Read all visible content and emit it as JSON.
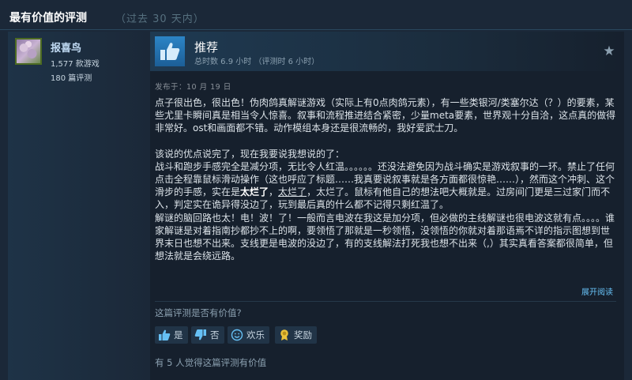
{
  "header": {
    "title": "最有价值的评测",
    "subtitle": "（过去 30 天内）"
  },
  "author": {
    "name": "报喜鸟",
    "games": "1,577 款游戏",
    "reviews": "180 篇评测"
  },
  "review": {
    "recommendation": "推荐",
    "hours": "总时数 6.9 小时 （评测时 6 小时）",
    "posted": "发布于：10 月 19 日",
    "paragraphs": [
      "点子很出色，很出色！伪肉鸽真解谜游戏（实际上有0点肉鸽元素），有一些类银河/类塞尔达（？）的要素，某些尤里卡瞬间真是相当令人惊喜。叙事和流程推进结合紧密，少量meta要素，世界观十分自洽，这点真的做得非常好。ost和画面都不错。动作模组本身还是很流畅的，我好爱武士刀。",
      "该说的优点说完了，现在我要说我想说的了："
    ],
    "para3_a": "战斗和跑步手感完全是减分项，无比令人红温。。。。。。还没法避免因为战斗确实是游戏叙事的一环。禁止了任何点击全程靠鼠标滑动操作（这也呼应了标题……我真要说叙事就是各方面都很惊艳……），然而这个冲刺、这个滑步的手感，实在是",
    "para3_bold": "太烂了",
    "para3_sep": "，",
    "para3_underline": "太烂了",
    "para3_b": "，太烂了。鼠标有他自己的想法吧大概就是。过房间门更是三过家门而不入，判定实在诡异得没边了，玩到最后真的什么都不记得只剩红温了。",
    "para4": "解谜的脑回路也太！电！波！了！一般而言电波在我这是加分项，但必做的主线解谜也很电波这就有点。。。。谁家解谜是对着指南抄都抄不上的啊，要领悟了那就是一秒领悟，没领悟的你就对着那语焉不详的指示图想到世界末日也想不出来。支线更是电波的没边了，有的支线解法打死我也想不出来（,）其实真看答案都很简单，但想法就是会绕远路。",
    "expand": "展开阅读"
  },
  "feedback": {
    "question": "这篇评测是否有价值?",
    "yes": "是",
    "no": "否",
    "funny": "欢乐",
    "award": "奖励",
    "count": "有 5 人觉得这篇评测有价值"
  },
  "icons": [
    "thumbs-up-icon",
    "star-icon",
    "thumbs-down-icon",
    "smile-icon",
    "award-icon"
  ],
  "colors": {
    "background": "#1b2838",
    "accent_link": "#67c1f5",
    "thumb_blue": "#2c85c6"
  }
}
